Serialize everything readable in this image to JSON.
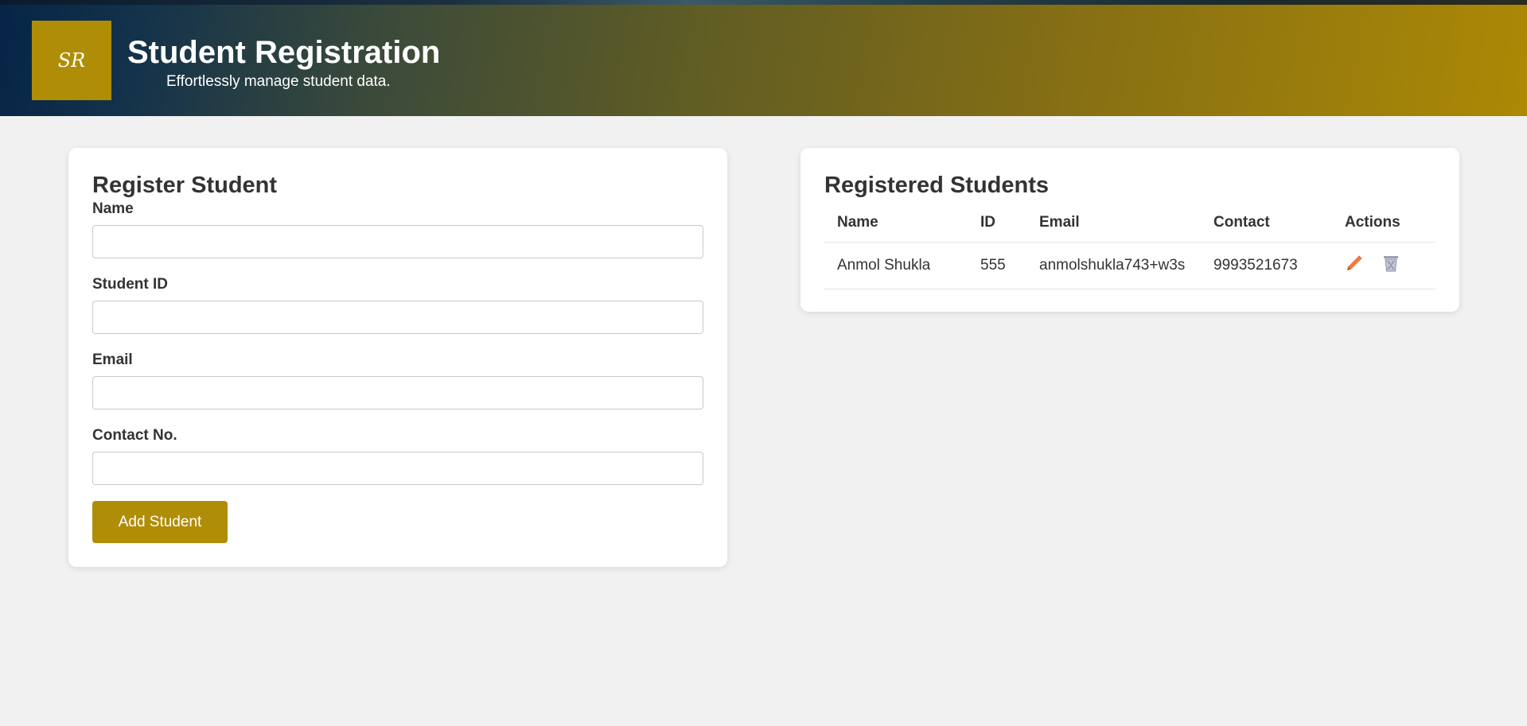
{
  "header": {
    "logo_text": "SR",
    "title": "Student Registration",
    "subtitle": "Effortlessly manage student data."
  },
  "form": {
    "title": "Register Student",
    "fields": [
      {
        "label": "Name",
        "value": ""
      },
      {
        "label": "Student ID",
        "value": ""
      },
      {
        "label": "Email",
        "value": ""
      },
      {
        "label": "Contact No.",
        "value": ""
      }
    ],
    "submit_label": "Add Student"
  },
  "list": {
    "title": "Registered Students",
    "columns": [
      "Name",
      "ID",
      "Email",
      "Contact",
      "Actions"
    ],
    "rows": [
      {
        "name": "Anmol Shukla",
        "id": "555",
        "email": "anmolshukla743+w3s",
        "contact": "9993521673",
        "actions": [
          "pencil-icon",
          "trash-icon"
        ]
      }
    ]
  },
  "colors": {
    "accent": "#b08d07",
    "edit_icon": "#f07a3f",
    "delete_icon": "#9aa0b8",
    "background": "#f1f1f1"
  }
}
